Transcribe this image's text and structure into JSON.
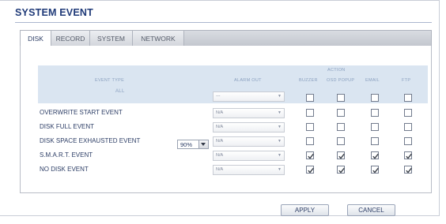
{
  "window": {
    "title": "SYSTEM EVENT"
  },
  "tabs": [
    "DISK",
    "RECORD",
    "SYSTEM",
    "NETWORK"
  ],
  "active_tab": "DISK",
  "table": {
    "col_event_type": "EVENT TYPE",
    "col_alarm_out": "ALARM OUT",
    "col_action": "ACTION",
    "action_columns": [
      "BUZZER",
      "OSD POPUP",
      "EMAIL",
      "FTP"
    ],
    "all_row": {
      "label": "ALL",
      "alarm_out": "---",
      "checks": [
        false,
        false,
        false,
        false
      ]
    },
    "rows": [
      {
        "label": "OVERWRITE START EVENT",
        "alarm_out": "N/A",
        "checks": [
          false,
          false,
          false,
          false
        ]
      },
      {
        "label": "DISK FULL EVENT",
        "alarm_out": "N/A",
        "checks": [
          false,
          false,
          false,
          false
        ]
      },
      {
        "label": "DISK SPACE EXHAUSTED EVENT",
        "alarm_out": "N/A",
        "checks": [
          false,
          false,
          false,
          false
        ]
      },
      {
        "label": "S.M.A.R.T. EVENT",
        "alarm_out": "N/A",
        "checks": [
          true,
          true,
          true,
          true
        ]
      },
      {
        "label": "NO DISK EVENT",
        "alarm_out": "N/A",
        "checks": [
          true,
          true,
          true,
          true
        ]
      }
    ],
    "threshold": "90%"
  },
  "buttons": {
    "apply": "APPLY",
    "cancel": "CANCEL"
  }
}
